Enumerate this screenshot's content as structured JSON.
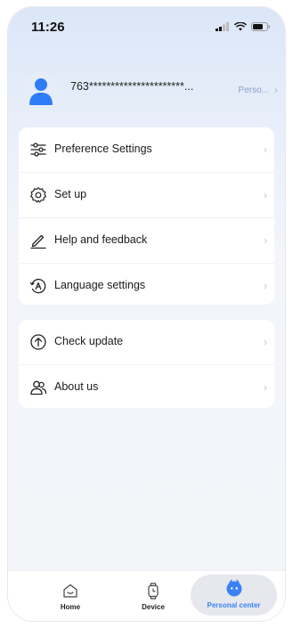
{
  "status_bar": {
    "time": "11:26"
  },
  "profile": {
    "phone_masked": "763**********************...",
    "personal_link": "Perso...",
    "chevron": "›"
  },
  "menu_group_1": [
    {
      "label": "Preference Settings",
      "icon": "sliders-icon"
    },
    {
      "label": "Set up",
      "icon": "gear-icon"
    },
    {
      "label": "Help and feedback",
      "icon": "pencil-icon"
    },
    {
      "label": "Language settings",
      "icon": "translate-icon"
    }
  ],
  "menu_group_2": [
    {
      "label": "Check update",
      "icon": "arrow-up-circle-icon"
    },
    {
      "label": "About us",
      "icon": "users-icon"
    }
  ],
  "row_chevron": "›",
  "tabbar": {
    "home": "Home",
    "device": "Device",
    "personal_center": "Personal center",
    "active_color": "#3b82f6"
  }
}
